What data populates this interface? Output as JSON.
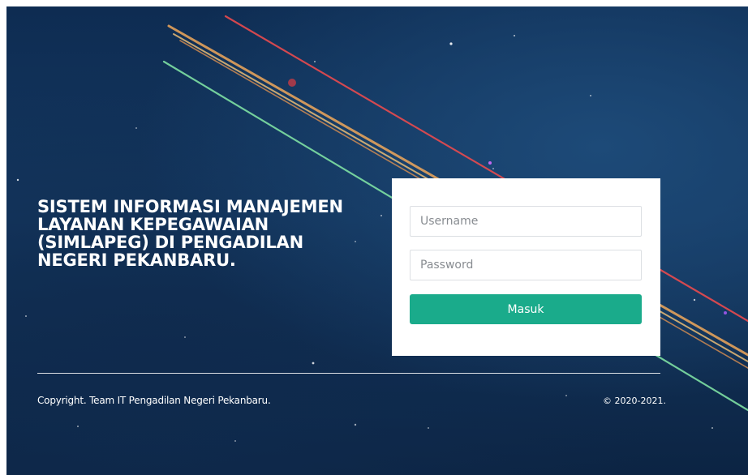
{
  "hero": {
    "title": "SISTEM INFORMASI MANAJEMEN LAYANAN KEPEGAWAIAN (SIMLAPEG) DI PENGADILAN NEGERI PEKANBARU."
  },
  "login": {
    "username_placeholder": "Username",
    "username_value": "",
    "password_placeholder": "Password",
    "password_value": "",
    "submit_label": "Masuk"
  },
  "footer": {
    "copyright": "Copyright. Team IT Pengadilan Negeri Pekanbaru.",
    "year": "© 2020-2021."
  },
  "colors": {
    "background": "#143861",
    "button": "#1aab8b",
    "text": "#ffffff"
  }
}
